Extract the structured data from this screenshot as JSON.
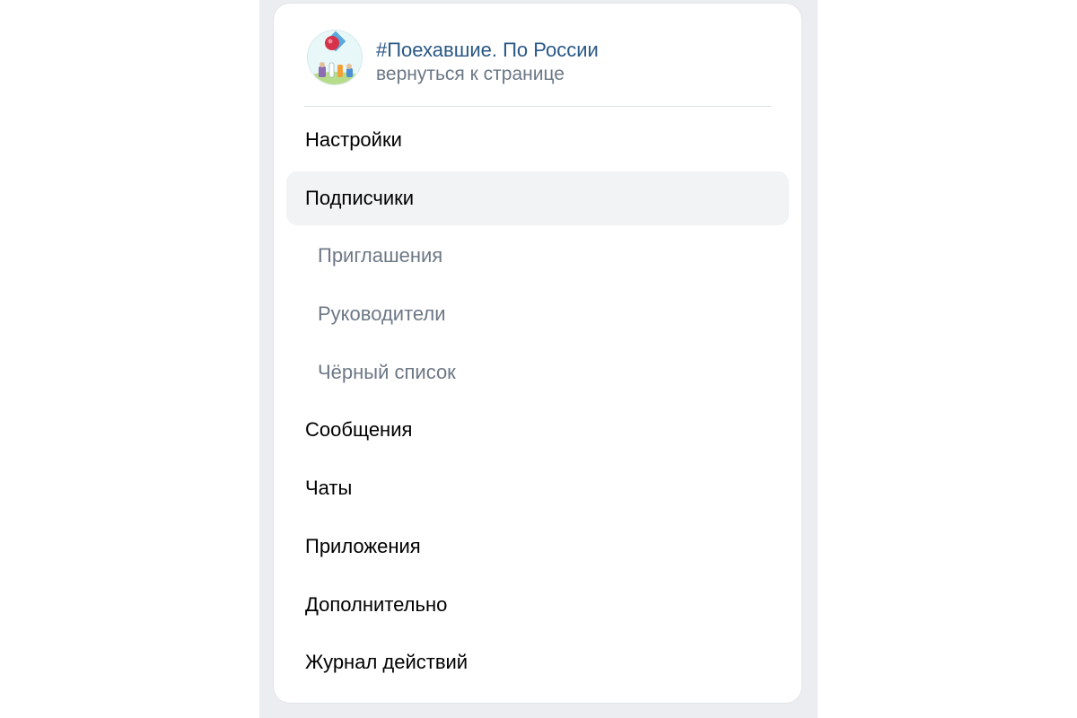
{
  "header": {
    "group_title": "#Поехавшие. По России",
    "back_link": "вернуться к странице",
    "avatar_icon": "group-avatar-icon"
  },
  "menu": {
    "items": [
      {
        "label": "Настройки",
        "level": 0,
        "active": false
      },
      {
        "label": "Подписчики",
        "level": 0,
        "active": true
      },
      {
        "label": "Приглашения",
        "level": 1,
        "active": false
      },
      {
        "label": "Руководители",
        "level": 1,
        "active": false
      },
      {
        "label": "Чёрный список",
        "level": 1,
        "active": false
      },
      {
        "label": "Сообщения",
        "level": 0,
        "active": false
      },
      {
        "label": "Чаты",
        "level": 0,
        "active": false
      },
      {
        "label": "Приложения",
        "level": 0,
        "active": false
      },
      {
        "label": "Дополнительно",
        "level": 0,
        "active": false
      },
      {
        "label": "Журнал действий",
        "level": 0,
        "active": false
      }
    ]
  },
  "colors": {
    "link": "#2a5885",
    "secondary_text": "#6d7885",
    "active_item_bg": "#f2f3f5",
    "page_band": "#ebedf0"
  }
}
